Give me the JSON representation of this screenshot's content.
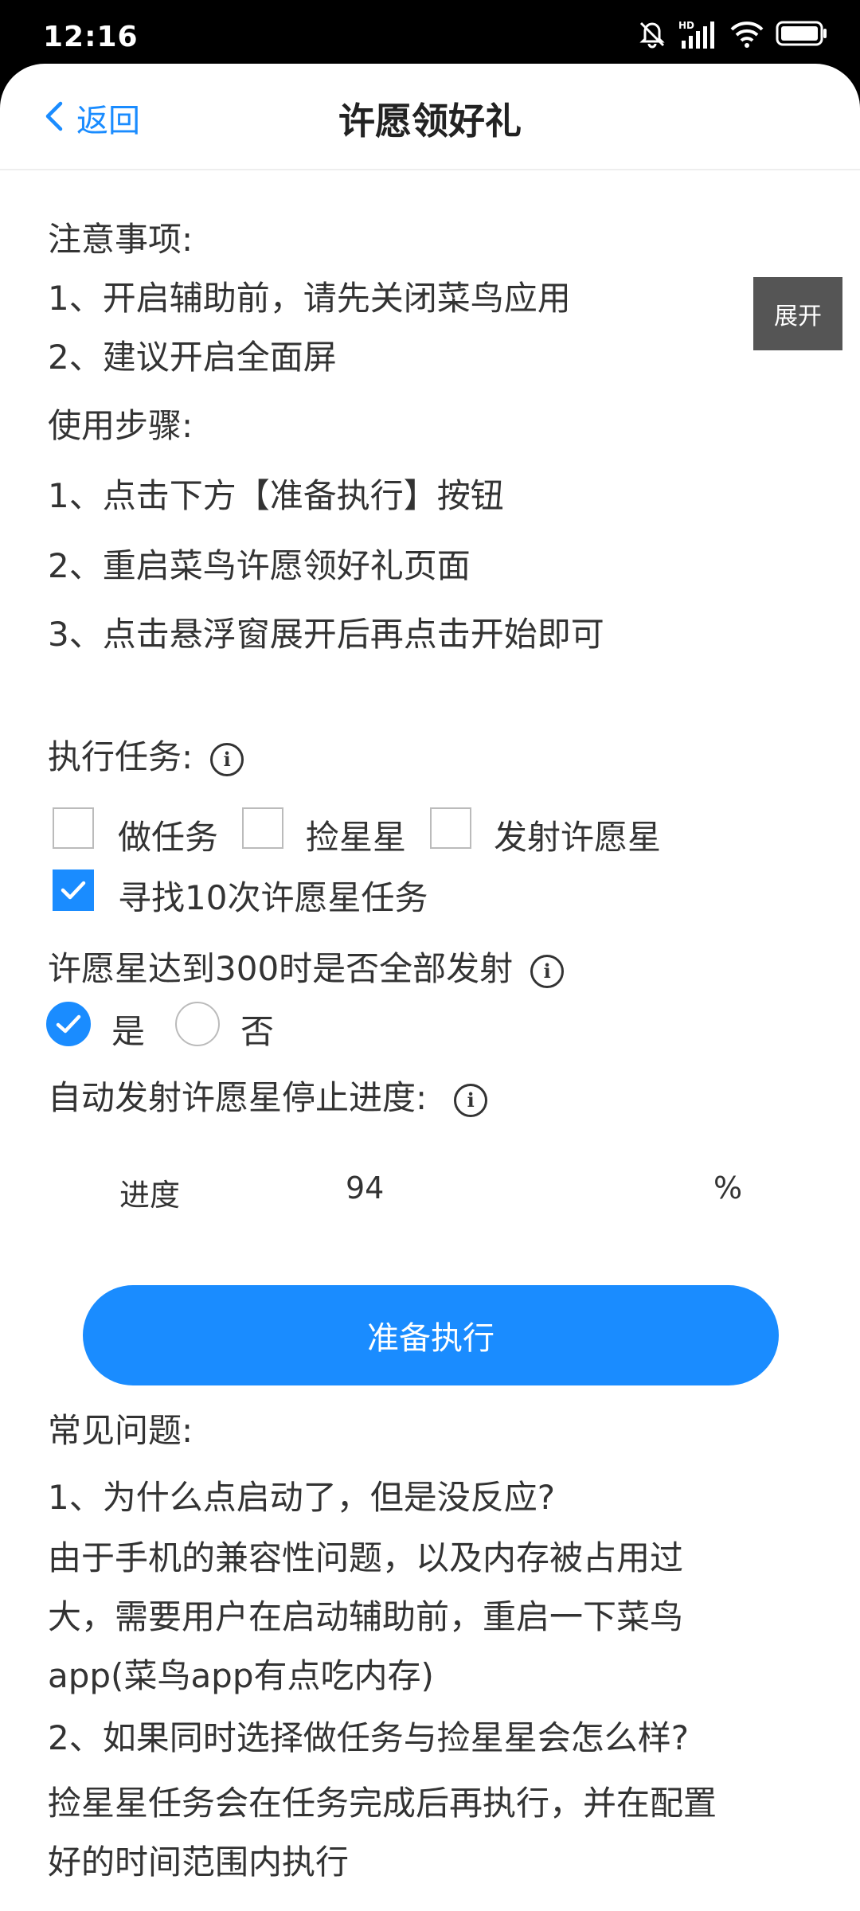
{
  "status_bar": {
    "time": "12:16",
    "network_badge": "HD"
  },
  "header": {
    "back_label": "返回",
    "title": "许愿领好礼"
  },
  "floating": {
    "expand_label": "展开"
  },
  "notes": {
    "title": "注意事项:",
    "items": [
      "1、开启辅助前，请先关闭菜鸟应用",
      "2、建议开启全面屏"
    ]
  },
  "steps": {
    "title": "使用步骤:",
    "items": [
      "1、点击下方【准备执行】按钮",
      "2、重启菜鸟许愿领好礼页面",
      "3、点击悬浮窗展开后再点击开始即可"
    ]
  },
  "tasks": {
    "title": "执行任务:",
    "options": [
      {
        "label": "做任务",
        "checked": false
      },
      {
        "label": "捡星星",
        "checked": false
      },
      {
        "label": "发射许愿星",
        "checked": false
      },
      {
        "label": "寻找10次许愿星任务",
        "checked": true
      }
    ]
  },
  "launch_all": {
    "question": "许愿星达到300时是否全部发射",
    "options": [
      {
        "label": "是",
        "selected": true
      },
      {
        "label": "否",
        "selected": false
      }
    ]
  },
  "progress": {
    "title": "自动发射许愿星停止进度:",
    "label": "进度",
    "value": "94",
    "unit": "%"
  },
  "primary_button": {
    "label": "准备执行"
  },
  "faq": {
    "title": "常见问题:",
    "q1": "1、为什么点启动了，但是没反应?",
    "a1_lines": [
      "由于手机的兼容性问题，以及内存被占用过",
      "大，需要用户在启动辅助前，重启一下菜鸟",
      "app(菜鸟app有点吃内存)"
    ],
    "q2": "2、如果同时选择做任务与捡星星会怎么样?",
    "a2_lines": [
      "捡星星任务会在任务完成后再执行，并在配置",
      "好的时间范围内执行"
    ]
  },
  "colors": {
    "accent": "#1a8cff",
    "expand_bg": "#555555",
    "text": "#333333"
  }
}
